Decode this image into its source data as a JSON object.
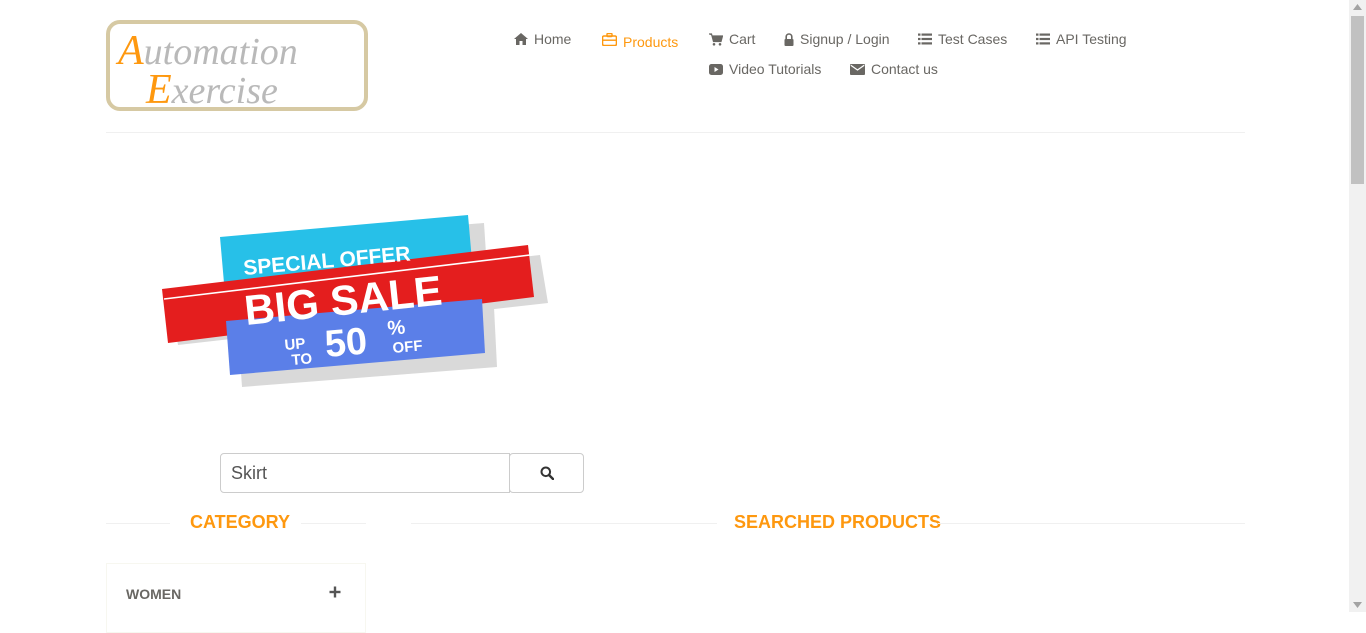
{
  "logo": {
    "line1": "Automation",
    "line2": "Exercise"
  },
  "nav": {
    "home": "Home",
    "products": "Products",
    "cart": "Cart",
    "signup_login": "Signup / Login",
    "test_cases": "Test Cases",
    "api_testing": "API Testing",
    "video_tutorials": "Video Tutorials",
    "contact_us": "Contact us"
  },
  "banner": {
    "special_offer": "SPECIAL OFFER",
    "big_sale": "BIG SALE",
    "up": "UP",
    "to": "TO",
    "amount": "50",
    "percent": "%",
    "off": "OFF"
  },
  "search": {
    "value": "Skirt"
  },
  "sections": {
    "category": "CATEGORY",
    "searched_products": "SEARCHED PRODUCTS"
  },
  "categories": [
    {
      "label": "WOMEN"
    }
  ],
  "colors": {
    "accent": "#fe980f",
    "nav_text": "#696763",
    "banner_red": "#e41e1e",
    "banner_cyan": "#27c0e8",
    "banner_blue": "#5b7fe8"
  }
}
